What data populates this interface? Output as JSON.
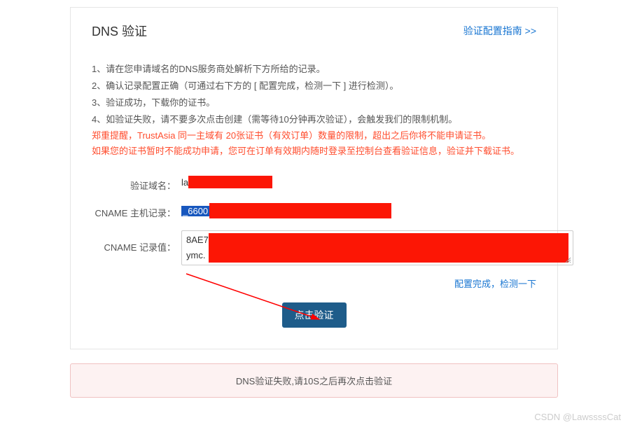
{
  "panel": {
    "title": "DNS 验证",
    "guide_link": "验证配置指南 >>",
    "instructions": {
      "line1": "1、请在您申请域名的DNS服务商处解析下方所给的记录。",
      "line2": "2、确认记录配置正确（可通过右下方的 [ 配置完成，检测一下 ] 进行检测）。",
      "line3": "3、验证成功，下载你的证书。",
      "line4": "4、如验证失败，请不要多次点击创建（需等待10分钟再次验证），会触发我们的限制机制。"
    },
    "warnings": {
      "line1": "郑重提醒，TrustAsia 同一主域有 20张证书（有效订单）数量的限制，超出之后你将不能申请证书。",
      "line2": "如果您的证书暂时不能成功申请，您可在订单有效期内随时登录至控制台查看验证信息，验证并下载证书。"
    },
    "form": {
      "domain_label": "验证域名：",
      "domain_prefix": "la",
      "cname_host_label": "CNAME 主机记录：",
      "cname_host_prefix": "_6600",
      "cname_value_label": "CNAME 记录值：",
      "cname_value_line1": "8AE7",
      "cname_value_line2": "ymc."
    },
    "actions": {
      "config_done": "配置完成，检测一下",
      "verify_button": "点击验证"
    }
  },
  "error_banner": "DNS验证失败,请10S之后再次点击验证",
  "watermark": "CSDN @LawssssCat"
}
